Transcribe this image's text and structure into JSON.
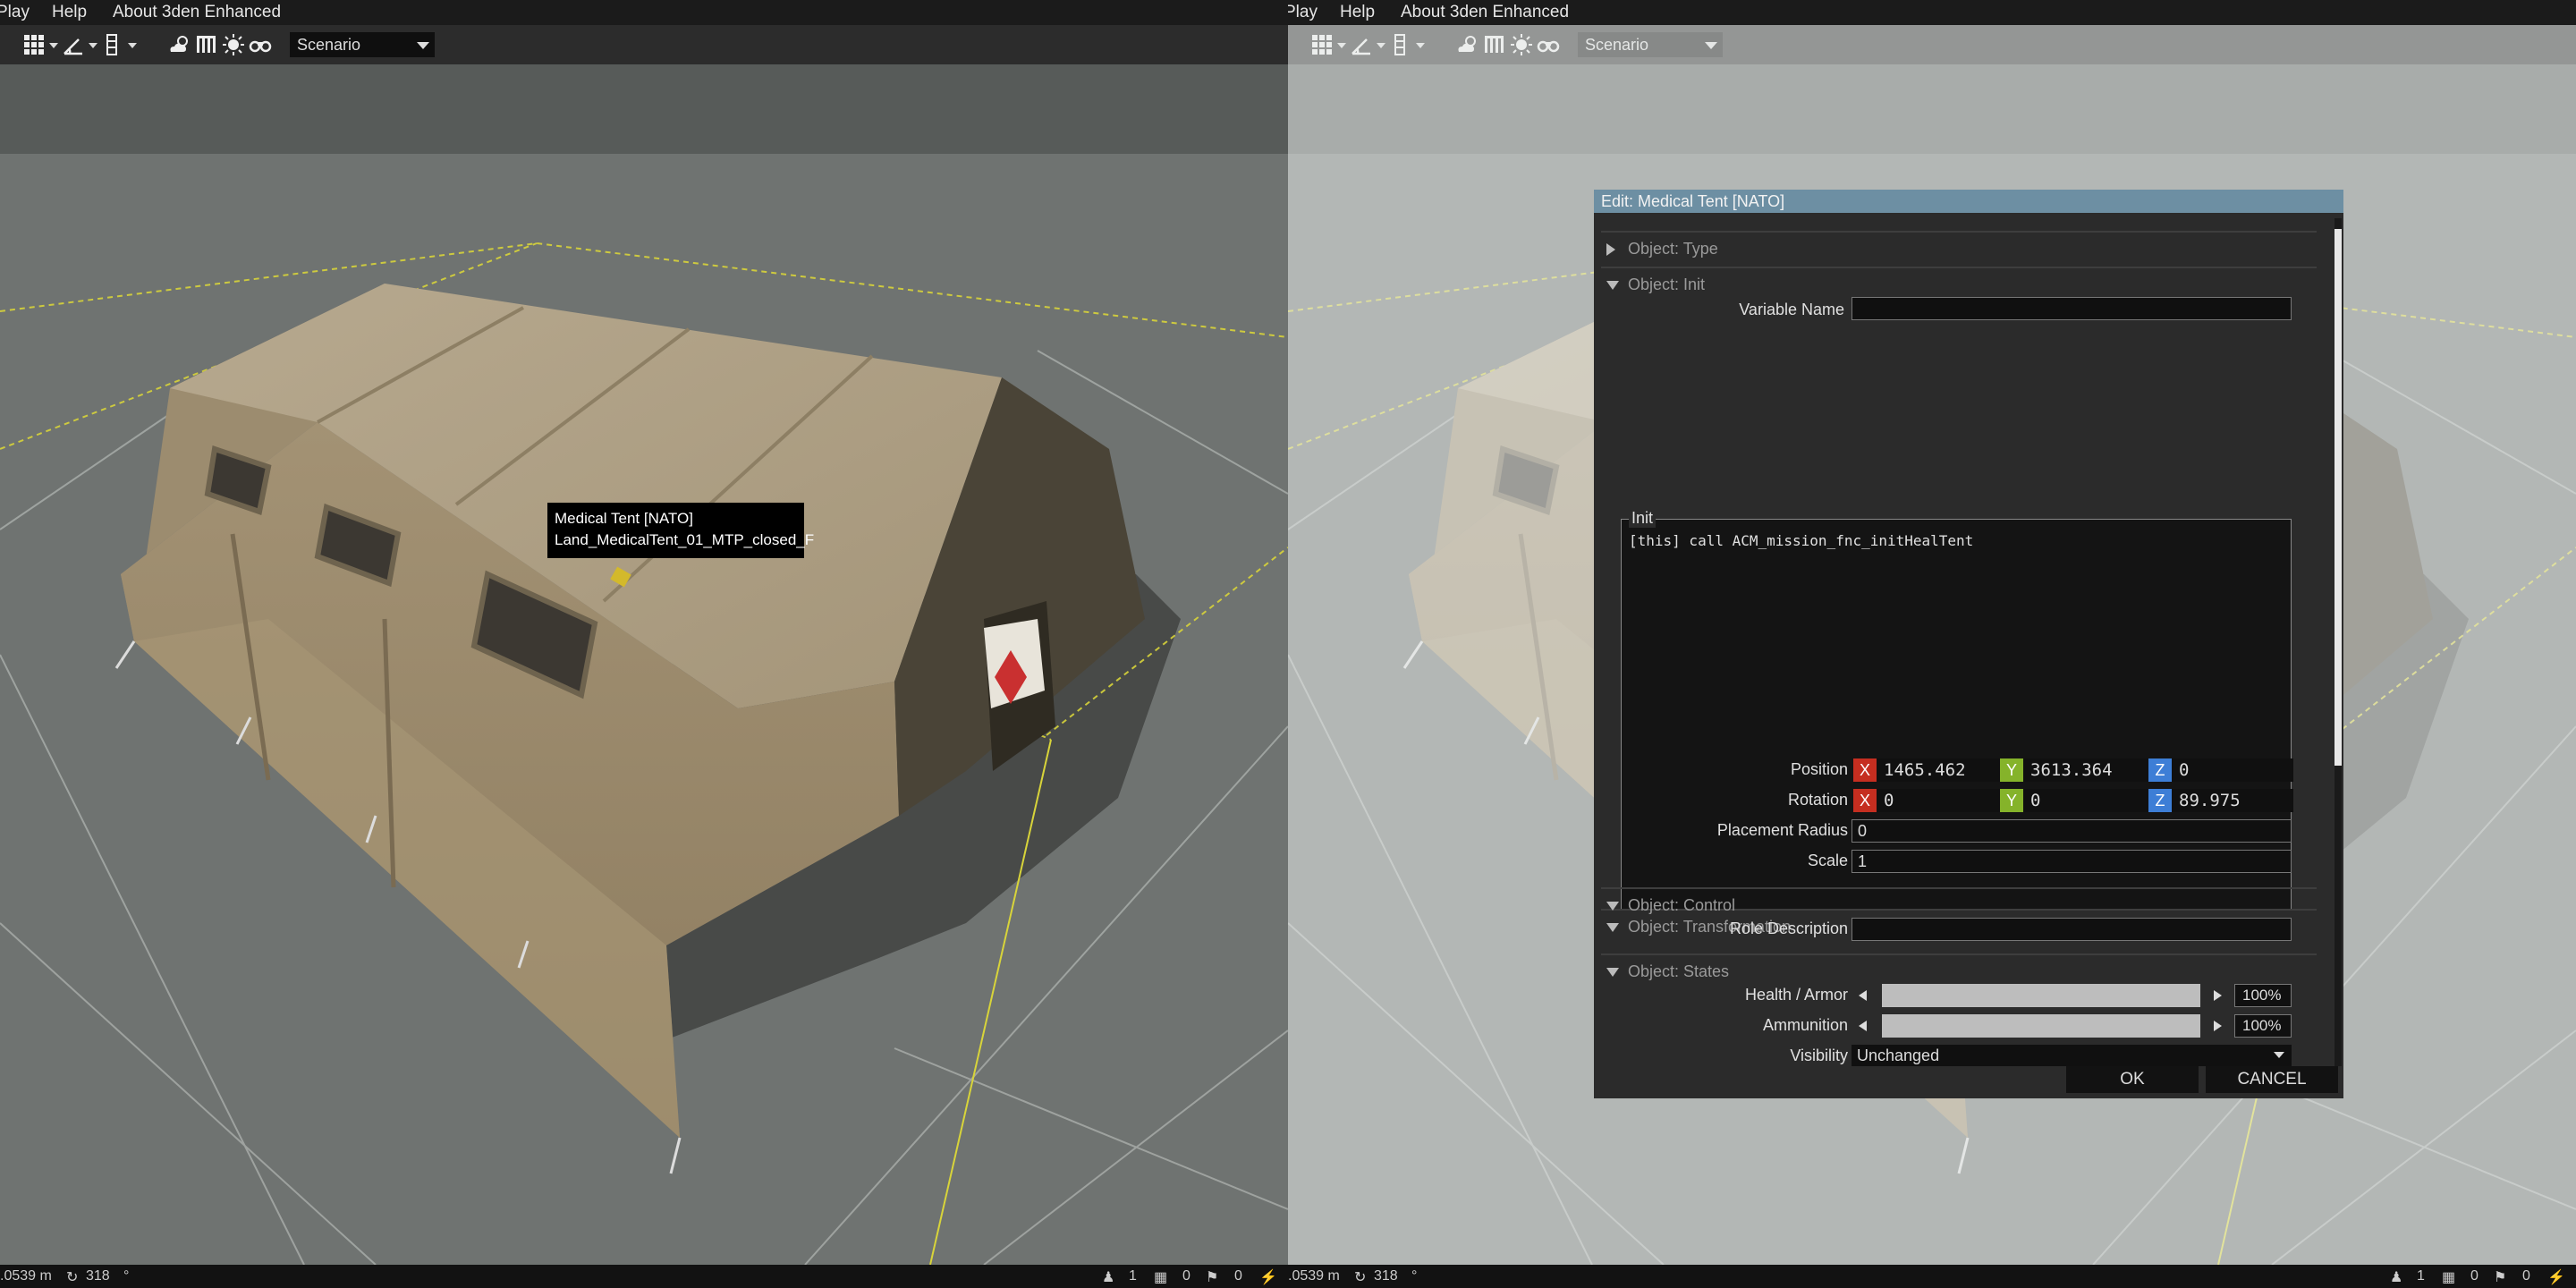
{
  "menu": {
    "play": "Play",
    "help": "Help",
    "about": "About 3den Enhanced"
  },
  "toolbar": {
    "scenario_label": "Scenario",
    "icons": [
      "grid-icon",
      "transform-icon",
      "snap-icon",
      "weather-icon",
      "lighting-icon",
      "sun-icon",
      "binoculars-icon"
    ]
  },
  "tooltip": {
    "line1": "Medical Tent [NATO]",
    "line2": "Land_MedicalTent_01_MTP_closed_F"
  },
  "status": {
    "distance": ".0539 m",
    "rotation": "318",
    "deg": "°",
    "c1": "1",
    "c2": "0",
    "c3": "0"
  },
  "dialog": {
    "title": "Edit: Medical Tent [NATO]",
    "sections": {
      "type": "Object: Type",
      "init": "Object: Init",
      "transformation": "Object: Transformation",
      "control": "Object: Control",
      "states": "Object: States"
    },
    "variable_name": {
      "label": "Variable Name",
      "value": ""
    },
    "init": {
      "label": "Init",
      "code": "[this] call ACM_mission_fnc_initHealTent"
    },
    "position": {
      "label": "Position",
      "x": "1465.462",
      "y": "3613.364",
      "z": "0"
    },
    "rotation": {
      "label": "Rotation",
      "x": "0",
      "y": "0",
      "z": "89.975"
    },
    "axis": {
      "x": "X",
      "y": "Y",
      "z": "Z"
    },
    "placement_radius": {
      "label": "Placement Radius",
      "value": "0"
    },
    "scale": {
      "label": "Scale",
      "value": "1"
    },
    "role_description": {
      "label": "Role Description",
      "value": ""
    },
    "health": {
      "label": "Health / Armor",
      "value": "100%",
      "level": 1.0
    },
    "ammunition": {
      "label": "Ammunition",
      "value": "100%",
      "level": 1.0
    },
    "visibility": {
      "label": "Visibility",
      "value": "Unchanged"
    },
    "ok": "OK",
    "cancel": "CANCEL"
  },
  "colors": {
    "axis_x": "#c52e20",
    "axis_y": "#85b32a",
    "axis_z": "#3d7ed6",
    "title_bar": "#6d8fa3"
  }
}
